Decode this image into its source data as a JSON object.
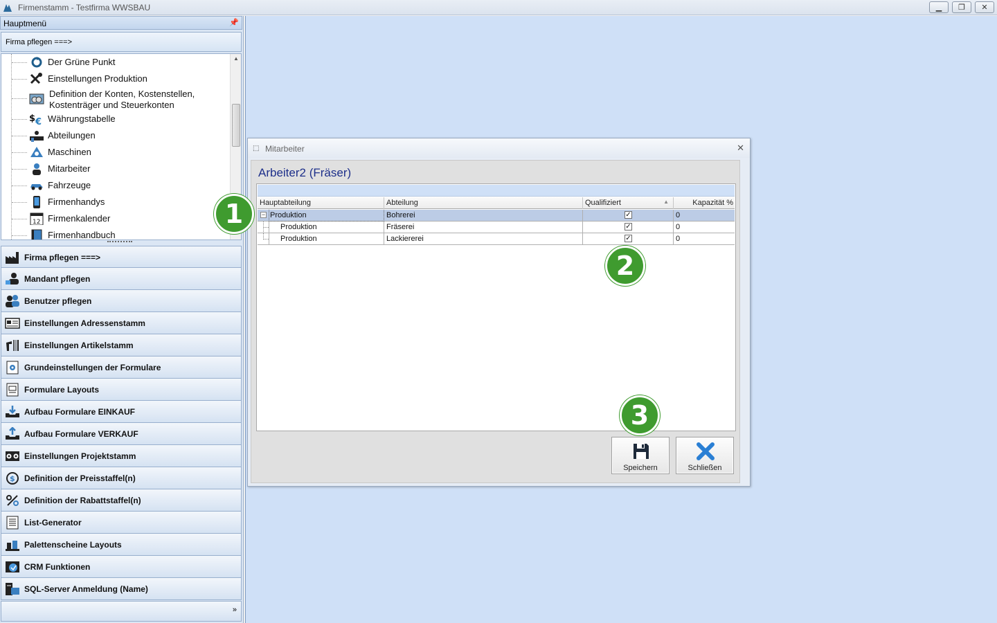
{
  "window": {
    "title": "Firmenstamm - Testfirma WWSBAU"
  },
  "sidebar": {
    "header": "Hauptmenü",
    "breadcrumb": "Firma pflegen   ===>",
    "tree_items": [
      {
        "label": "Der Grüne Punkt",
        "icon": "recycle-icon"
      },
      {
        "label": "Einstellungen Produktion",
        "icon": "tools-icon"
      },
      {
        "label": "Definition der Konten, Kostenstellen,\nKostenträger und Steuerkonten",
        "icon": "coins-icon"
      },
      {
        "label": "Währungstabelle",
        "icon": "currency-icon"
      },
      {
        "label": "Abteilungen",
        "icon": "department-icon"
      },
      {
        "label": "Maschinen",
        "icon": "machine-icon"
      },
      {
        "label": "Mitarbeiter",
        "icon": "worker-icon"
      },
      {
        "label": "Fahrzeuge",
        "icon": "car-icon"
      },
      {
        "label": "Firmenhandys",
        "icon": "phone-icon"
      },
      {
        "label": "Firmenkalender",
        "icon": "calendar-icon"
      },
      {
        "label": "Firmenhandbuch",
        "icon": "book-icon"
      }
    ],
    "menu_items": [
      {
        "label": "Firma pflegen   ===>",
        "icon": "factory-icon"
      },
      {
        "label": "Mandant pflegen",
        "icon": "client-icon"
      },
      {
        "label": "Benutzer pflegen",
        "icon": "users-icon"
      },
      {
        "label": "Einstellungen Adressenstamm",
        "icon": "address-card-icon"
      },
      {
        "label": "Einstellungen Artikelstamm",
        "icon": "barcode-icon"
      },
      {
        "label": "Grundeinstellungen der Formulare",
        "icon": "form-settings-icon"
      },
      {
        "label": "Formulare Layouts",
        "icon": "layout-icon"
      },
      {
        "label": "Aufbau Formulare EINKAUF",
        "icon": "download-tray-icon"
      },
      {
        "label": "Aufbau Formulare VERKAUF",
        "icon": "upload-tray-icon"
      },
      {
        "label": "Einstellungen Projektstamm",
        "icon": "project-icon"
      },
      {
        "label": "Definition der Preisstaffel(n)",
        "icon": "price-icon"
      },
      {
        "label": "Definition der Rabattstaffel(n)",
        "icon": "percent-icon"
      },
      {
        "label": "List-Generator",
        "icon": "list-icon"
      },
      {
        "label": "Palettenscheine Layouts",
        "icon": "pallet-icon"
      },
      {
        "label": "CRM Funktionen",
        "icon": "crm-icon"
      },
      {
        "label": "SQL-Server Anmeldung (Name)",
        "icon": "server-icon"
      }
    ],
    "footer_more": "»"
  },
  "dialog": {
    "title": "Mitarbeiter",
    "heading": "Arbeiter2 (Fräser)",
    "columns": [
      "Hauptabteilung",
      "Abteilung",
      "Qualifiziert",
      "Kapazität %"
    ],
    "rows": [
      {
        "haupt": "Produktion",
        "abteilung": "Bohrerei",
        "qualifiziert": true,
        "kapazitaet": "0"
      },
      {
        "haupt": "Produktion",
        "abteilung": "Fräserei",
        "qualifiziert": true,
        "kapazitaet": "0"
      },
      {
        "haupt": "Produktion",
        "abteilung": "Lackiererei",
        "qualifiziert": true,
        "kapazitaet": "0"
      }
    ],
    "buttons": {
      "save": "Speichern",
      "close": "Schließen"
    }
  },
  "markers": [
    "1",
    "2",
    "3"
  ],
  "colors": {
    "marker": "#3f9b2f",
    "heading": "#1d2f8a",
    "mdi_bg": "#cfe0f7"
  }
}
